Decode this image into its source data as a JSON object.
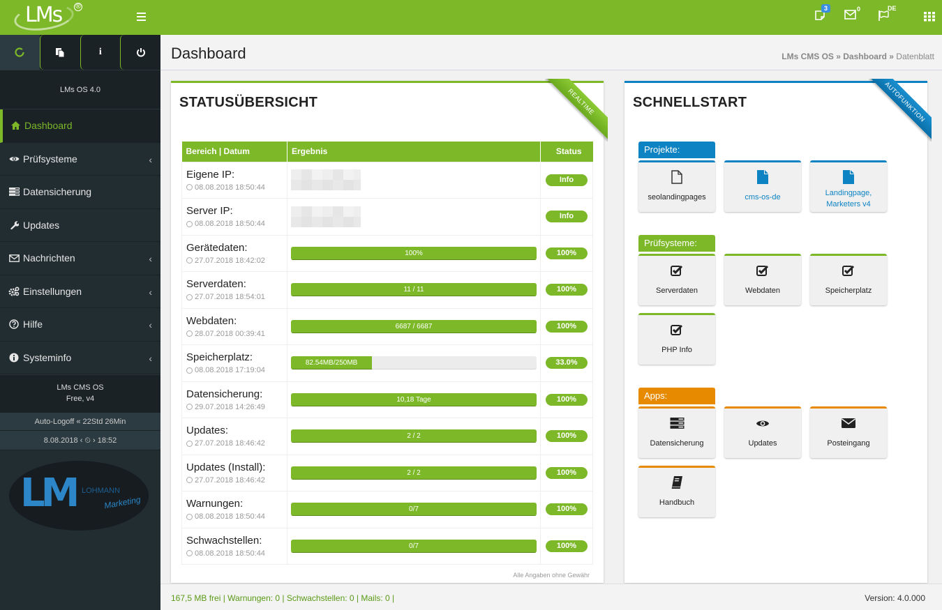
{
  "app": {
    "logo_text": "LMs",
    "logo_reg": "®"
  },
  "topbar": {
    "notes_badge": "3",
    "mail_badge": "0",
    "lang_badge": "DE"
  },
  "sidebar": {
    "version": "LMs OS 4.0",
    "nav": [
      {
        "label": "Dashboard",
        "icon": "home-icon",
        "active": true,
        "chevron": false
      },
      {
        "label": "Prüfsysteme",
        "icon": "eye-icon",
        "active": false,
        "chevron": true
      },
      {
        "label": "Datensicherung",
        "icon": "server-icon",
        "active": false,
        "chevron": false
      },
      {
        "label": "Updates",
        "icon": "wrench-icon",
        "active": false,
        "chevron": false
      },
      {
        "label": "Nachrichten",
        "icon": "envelope-icon",
        "active": false,
        "chevron": true
      },
      {
        "label": "Einstellungen",
        "icon": "cogs-icon",
        "active": false,
        "chevron": true
      },
      {
        "label": "Hilfe",
        "icon": "question-icon",
        "active": false,
        "chevron": true
      },
      {
        "label": "Systeminfo",
        "icon": "info-icon",
        "active": false,
        "chevron": true
      }
    ],
    "chevron_glyph": "‹",
    "cms_line1": "LMs CMS OS",
    "cms_line2": "Free, v4",
    "autologoff": "Auto-Logoff « 22Std 26Min",
    "clock": "8.08.2018 ‹ ⏲ › 18:52",
    "brand_lm": "LM",
    "brand_name": "LOHMANN",
    "brand_sub": "Marketing"
  },
  "header": {
    "title": "Dashboard",
    "breadcrumb": {
      "item1": "LMs CMS OS",
      "sep": " » ",
      "item2": "Dashboard",
      "item3": "Datenblatt"
    }
  },
  "status": {
    "title": "STATUSÜBERSICHT",
    "ribbon": "REALTIME",
    "columns": [
      "Bereich | Datum",
      "Ergebnis",
      "Status"
    ],
    "rows": [
      {
        "label": "Eigene IP:",
        "date": "08.08.2018 18:50:44",
        "type": "blur",
        "status": "Info"
      },
      {
        "label": "Server IP:",
        "date": "08.08.2018 18:50:44",
        "type": "blur",
        "status": "Info"
      },
      {
        "label": "Gerätedaten:",
        "date": "27.07.2018 18:42:02",
        "type": "bar",
        "bar_text": "100%",
        "progress": 1.0,
        "status": "100%"
      },
      {
        "label": "Serverdaten:",
        "date": "27.07.2018 18:54:01",
        "type": "bar",
        "bar_text": "11 / 11",
        "progress": 1.0,
        "status": "100%"
      },
      {
        "label": "Webdaten:",
        "date": "28.07.2018 00:39:41",
        "type": "bar",
        "bar_text": "6687 / 6687",
        "progress": 1.0,
        "status": "100%"
      },
      {
        "label": "Speicherplatz:",
        "date": "08.08.2018 17:19:04",
        "type": "bar",
        "bar_text": "82.54MB/250MB",
        "progress": 0.33,
        "status": "33.0%"
      },
      {
        "label": "Datensicherung:",
        "date": "29.07.2018 14:26:49",
        "type": "bar",
        "bar_text": "10,18 Tage",
        "progress": 1.0,
        "status": "100%"
      },
      {
        "label": "Updates:",
        "date": "27.07.2018 18:46:42",
        "type": "bar",
        "bar_text": "2 / 2",
        "progress": 1.0,
        "status": "100%"
      },
      {
        "label": "Updates (Install):",
        "date": "27.07.2018 18:46:42",
        "type": "bar",
        "bar_text": "2 / 2",
        "progress": 1.0,
        "status": "100%"
      },
      {
        "label": "Warnungen:",
        "date": "08.08.2018 18:50:44",
        "type": "bar",
        "bar_text": "0/7",
        "progress": 1.0,
        "status": "100%"
      },
      {
        "label": "Schwachstellen:",
        "date": "08.08.2018 18:50:44",
        "type": "bar",
        "bar_text": "0/7",
        "progress": 1.0,
        "status": "100%"
      }
    ],
    "disclaimer": "Alle Angaben ohne Gewähr"
  },
  "quickstart": {
    "title": "SCHNELLSTART",
    "ribbon": "AUTOFUNKTION",
    "groups": [
      {
        "label": "Projekte:",
        "color": "#0d83c4",
        "tiles": [
          {
            "label": "seolandingpages",
            "icon": "file-outline-icon",
            "blue": false
          },
          {
            "label": "cms-os-de",
            "icon": "file-icon",
            "blue": true
          },
          {
            "label": "Landingpage, Marketers v4",
            "icon": "file-icon",
            "blue": true
          }
        ]
      },
      {
        "label": "Prüfsysteme:",
        "color": "#7cb828",
        "tiles": [
          {
            "label": "Serverdaten",
            "icon": "checkbox-icon"
          },
          {
            "label": "Webdaten",
            "icon": "checkbox-icon"
          },
          {
            "label": "Speicherplatz",
            "icon": "checkbox-icon"
          },
          {
            "label": "PHP Info",
            "icon": "checkbox-icon"
          }
        ]
      },
      {
        "label": "Apps:",
        "color": "#e88a00",
        "tiles": [
          {
            "label": "Datensicherung",
            "icon": "server-icon"
          },
          {
            "label": "Updates",
            "icon": "eye-icon"
          },
          {
            "label": "Posteingang",
            "icon": "envelope-icon"
          },
          {
            "label": "Handbuch",
            "icon": "book-icon"
          }
        ]
      }
    ]
  },
  "footer": {
    "left": "167,5 MB frei | Warnungen: 0 | Schwachstellen: 0 | Mails: 0 |",
    "right": "Version: 4.0.000"
  },
  "colors": {
    "brand_green": "#7cb828",
    "brand_blue": "#0d83c4",
    "brand_orange": "#e88a00",
    "sidebar_dark": "#222d32"
  }
}
